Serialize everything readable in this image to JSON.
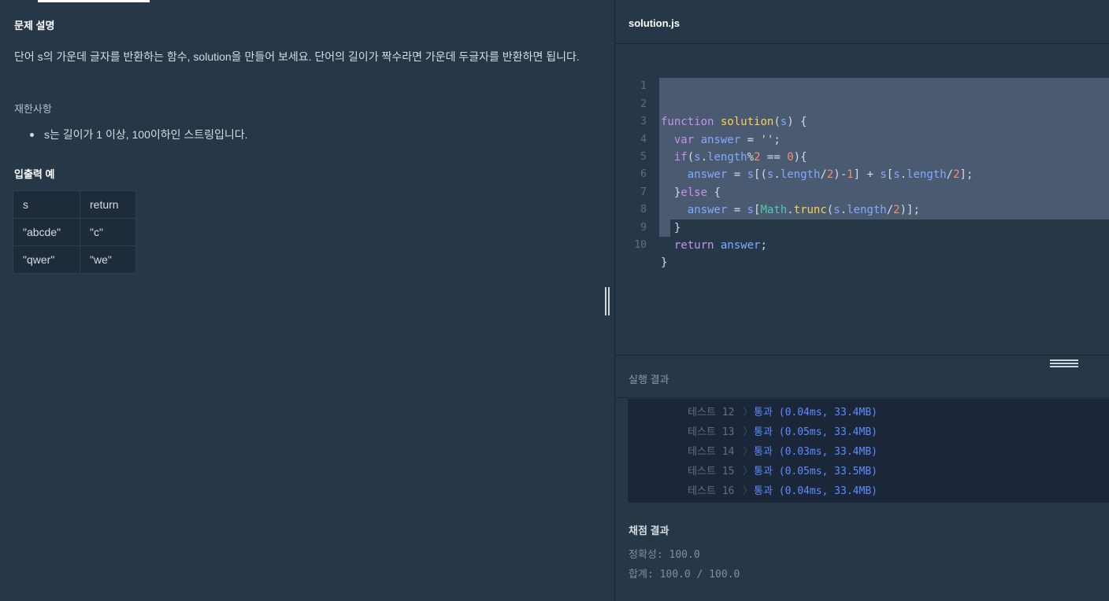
{
  "problem": {
    "section_title": "문제 설명",
    "description": "단어 s의 가운데 글자를 반환하는 함수, solution을 만들어 보세요. 단어의 길이가 짝수라면 가운데 두글자를 반환하면 됩니다.",
    "constraints_title": "재한사항",
    "constraints": [
      "s는 길이가 1 이상, 100이하인 스트링입니다."
    ],
    "io_title": "입출력 예",
    "io_table": {
      "headers": [
        "s",
        "return"
      ],
      "rows": [
        [
          "\"abcde\"",
          "\"c\""
        ],
        [
          "\"qwer\"",
          "\"we\""
        ]
      ]
    }
  },
  "editor": {
    "file_name": "solution.js",
    "line_numbers": [
      "1",
      "2",
      "3",
      "4",
      "5",
      "6",
      "7",
      "8",
      "9",
      "10"
    ],
    "code_lines": [
      "",
      "function solution(s) {",
      "  var answer = '';",
      "  if(s.length%2 == 0){",
      "    answer = s[(s.length/2)-1] + s[s.length/2];",
      "  }else {",
      "    answer = s[Math.trunc(s.length/2)];",
      "  }",
      "  return answer;",
      "}"
    ]
  },
  "results": {
    "title": "실행 결과",
    "rows": [
      {
        "label": "테스트 12",
        "status": "통과 (0.04ms, 33.4MB)"
      },
      {
        "label": "테스트 13",
        "status": "통과 (0.05ms, 33.4MB)"
      },
      {
        "label": "테스트 14",
        "status": "통과 (0.03ms, 33.4MB)"
      },
      {
        "label": "테스트 15",
        "status": "통과 (0.05ms, 33.5MB)"
      },
      {
        "label": "테스트 16",
        "status": "통과 (0.04ms, 33.4MB)"
      }
    ],
    "arrow": "〉"
  },
  "grading": {
    "title": "채점 결과",
    "accuracy": "정확성: 100.0",
    "total": "합계: 100.0 / 100.0"
  },
  "colors": {
    "background": "#263747",
    "pass_status": "#5a8dff",
    "keyword": "#c792ea",
    "function_name": "#ffd24d",
    "variable": "#82aaff",
    "number": "#f78c6c",
    "selection": "#4a5a70"
  }
}
